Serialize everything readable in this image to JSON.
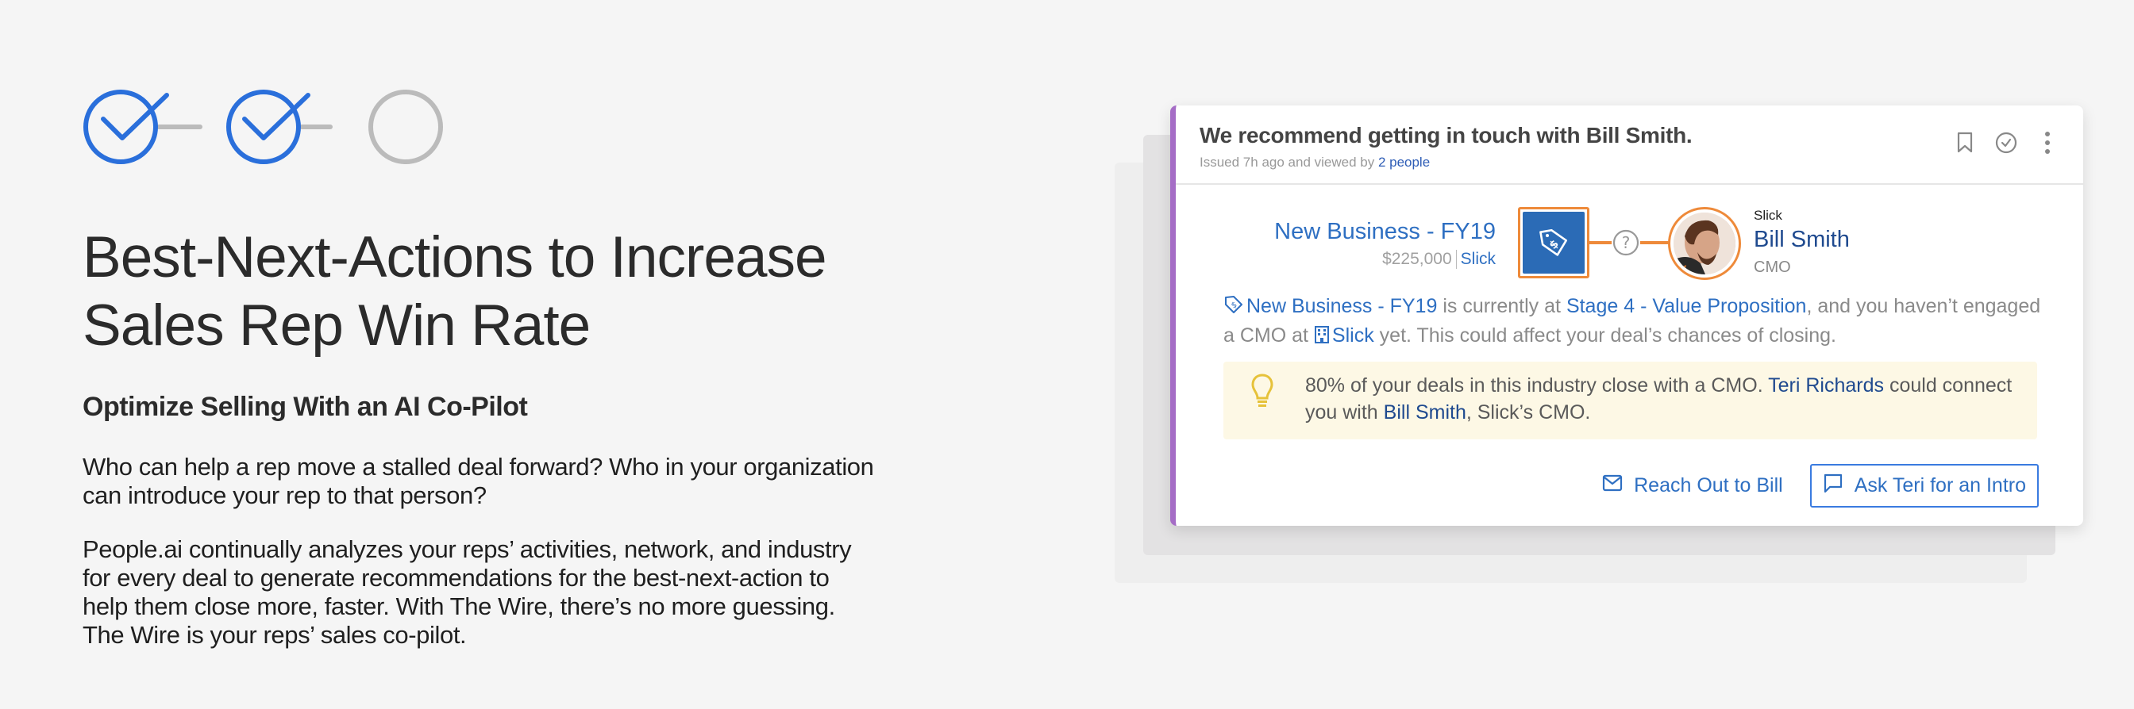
{
  "steps": [
    {
      "state": "complete",
      "icon": "check-circle-icon"
    },
    {
      "state": "complete",
      "icon": "check-circle-icon"
    },
    {
      "state": "pending",
      "icon": "empty-circle-icon"
    }
  ],
  "colors": {
    "accent_blue": "#2a6fdb",
    "step_gray": "#bbbbbb",
    "card_stripe": "#a56dc6",
    "highlight_orange": "#ee8a3a",
    "deal_tile_blue": "#2b6bb6",
    "tip_background": "#fdf8e5",
    "bulb_yellow": "#e6c23a"
  },
  "hero": {
    "title_line1": "Best-Next-Actions to Increase",
    "title_line2": "Sales Rep Win Rate",
    "subtitle": "Optimize Selling With an AI Co-Pilot",
    "paragraph1": "Who can help a rep move a stalled deal forward? Who in your organization can introduce your rep to that person?",
    "paragraph2": "People.ai continually analyzes your reps’ activities, network, and industry for every deal to generate recommendations for the best-next-action to help them close more, faster. With The Wire, there’s no more guessing. The Wire is your reps’ sales co-pilot."
  },
  "card": {
    "title": "We recommend getting in touch with Bill Smith.",
    "meta_prefix": "Issued 7h ago and viewed by ",
    "meta_link": "2 people",
    "header_icons": [
      "bookmark-icon",
      "check-circle-icon",
      "more-vertical-icon"
    ],
    "deal": {
      "name": "New Business - FY19",
      "amount": "$225,000",
      "account": "Slick",
      "icon": "price-tag-icon"
    },
    "connector_icon": "question-circle-icon",
    "person": {
      "company": "Slick",
      "name": "Bill Smith",
      "title": "CMO"
    },
    "insight": {
      "deal_link": "New Business - FY19",
      "text1": " is currently at ",
      "stage_link": "Stage 4 - Value Proposition",
      "text2": ", and you haven’t engaged a CMO at ",
      "account_link": "Slick",
      "text3": " yet. This could affect your deal’s chances of closing."
    },
    "tip": {
      "icon": "lightbulb-icon",
      "text1": "80% of your deals in this industry close with a CMO. ",
      "link1": "Teri Richards",
      "text2": " could connect you with ",
      "link2": "Bill Smith",
      "text3": ", Slick’s CMO."
    },
    "actions": {
      "reach_out_label": "Reach Out to Bill",
      "reach_out_icon": "mail-icon",
      "ask_intro_label": "Ask Teri for an Intro",
      "ask_intro_icon": "chat-bubble-icon"
    }
  }
}
